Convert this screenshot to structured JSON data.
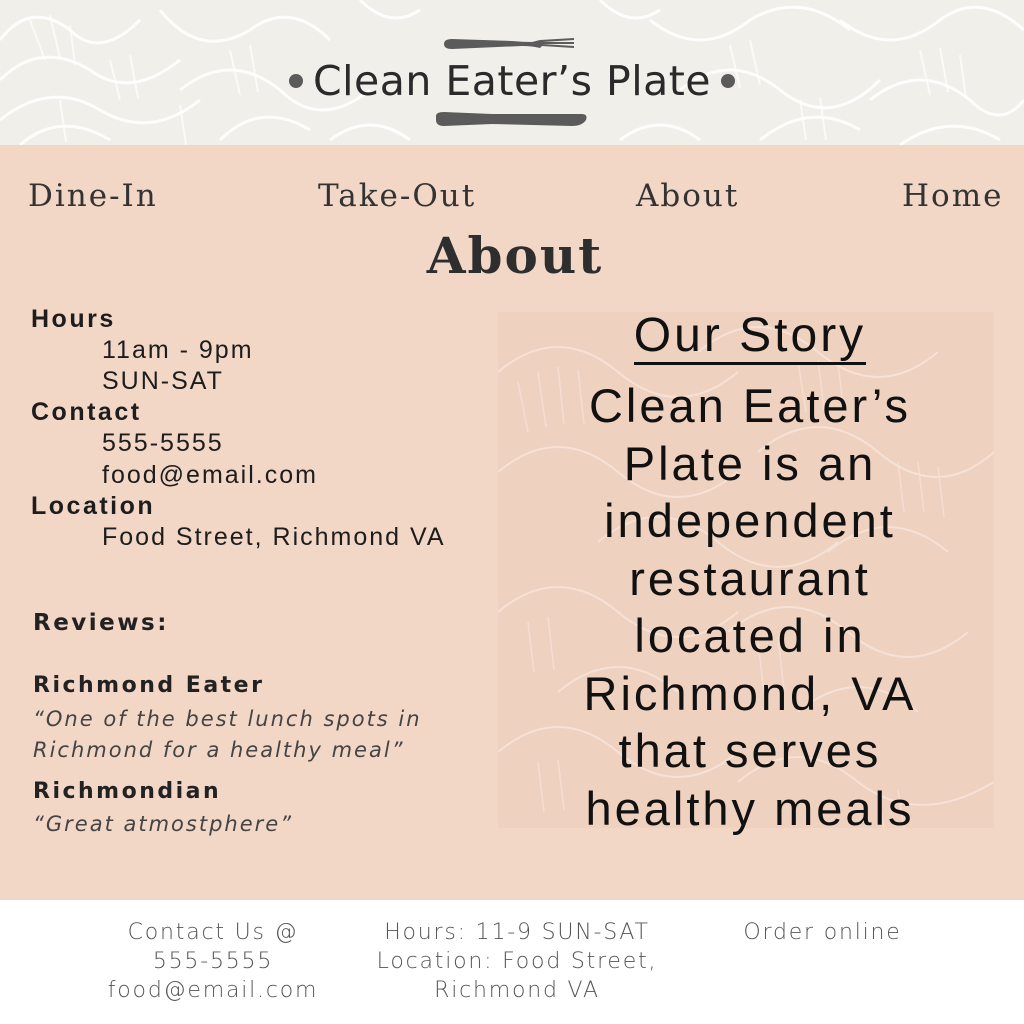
{
  "header": {
    "logo_text": "Clean Eater’s Plate"
  },
  "nav": {
    "items": [
      "Dine-In",
      "Take-Out",
      "About",
      "Home"
    ]
  },
  "page": {
    "title": "About"
  },
  "info": {
    "hours_heading": "Hours",
    "hours_time": "11am - 9pm",
    "hours_days": "SUN-SAT",
    "contact_heading": "Contact",
    "contact_phone": "555-5555",
    "contact_email": "food@email.com",
    "location_heading": "Location",
    "location_value": "Food Street, Richmond VA"
  },
  "reviews": {
    "title": "Reviews:",
    "items": [
      {
        "author": "Richmond Eater",
        "quote": "“One of the best lunch spots in Richmond for a healthy meal”"
      },
      {
        "author": "Richmondian",
        "quote": "“Great atmostphere”"
      }
    ]
  },
  "story": {
    "title": "Our Story",
    "lines": [
      "Clean Eater’s",
      "Plate is an",
      "independent",
      "restaurant",
      "located in",
      "Richmond, VA",
      "that serves",
      "healthy meals"
    ]
  },
  "footer": {
    "contact_line1": "Contact Us @",
    "contact_line2": "555-5555",
    "contact_line3": "food@email.com",
    "hours_line": "Hours: 11-9 SUN-SAT",
    "location_line1": "Location: Food Street,",
    "location_line2": "Richmond VA",
    "order_label": "Order online"
  },
  "colors": {
    "header_bg": "#f1efea",
    "main_bg": "#f2d6c6",
    "text_dark": "#1d1d1d",
    "footer_text": "#555555"
  },
  "icons": {
    "fork": "fork-icon",
    "knife": "knife-icon"
  }
}
